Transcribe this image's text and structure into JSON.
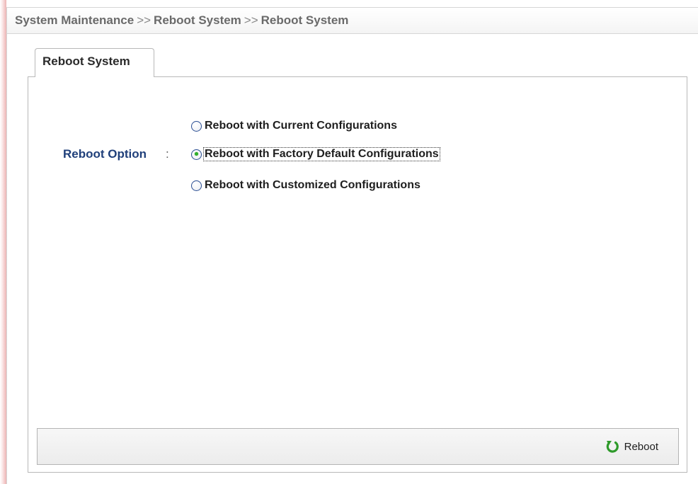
{
  "breadcrumb": {
    "part1": "System Maintenance",
    "sep1": ">>",
    "part2": "Reboot System",
    "sep2": ">>",
    "part3": "Reboot System"
  },
  "tab": {
    "label": "Reboot System"
  },
  "form": {
    "label": "Reboot Option",
    "colon": ":",
    "options": [
      {
        "label": "Reboot with Current Configurations",
        "checked": false
      },
      {
        "label": "Reboot with Factory Default Configurations",
        "checked": true
      },
      {
        "label": "Reboot with Customized Configurations",
        "checked": false
      }
    ]
  },
  "actions": {
    "reboot_label": "Reboot",
    "reboot_icon": "reboot-arrow-icon",
    "icon_color": "#2e9a2a"
  }
}
